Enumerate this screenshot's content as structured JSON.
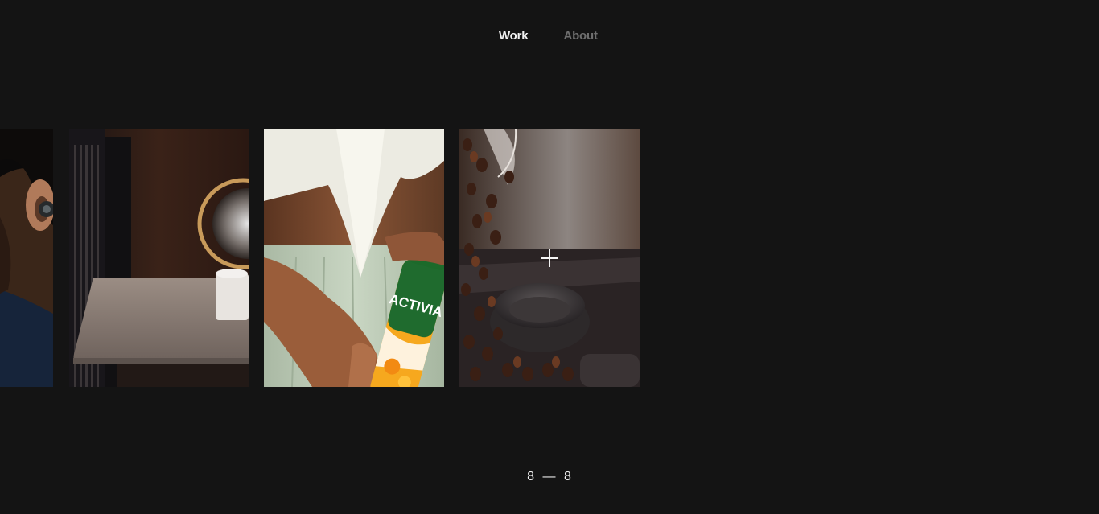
{
  "nav": {
    "items": [
      {
        "label": "Work",
        "active": true
      },
      {
        "label": "About",
        "active": false
      }
    ]
  },
  "gallery": {
    "tiles": [
      {
        "subject": "person-with-earbud",
        "icon": "earbud-portrait-image"
      },
      {
        "subject": "glass-sculpture-on-table",
        "icon": "glass-sculpture-image"
      },
      {
        "subject": "activia-drink-bottle",
        "icon": "yogurt-drink-image",
        "bottle_text": "ACTIVIA"
      },
      {
        "subject": "coffee-beans-grinder",
        "icon": "coffee-beans-image"
      }
    ]
  },
  "counter": {
    "current": "8",
    "separator": "—",
    "total": "8"
  },
  "colors": {
    "background": "#141414",
    "nav_active": "#f2f2f2",
    "nav_inactive": "#6f6f6f",
    "activia_green": "#1f6b2e"
  }
}
